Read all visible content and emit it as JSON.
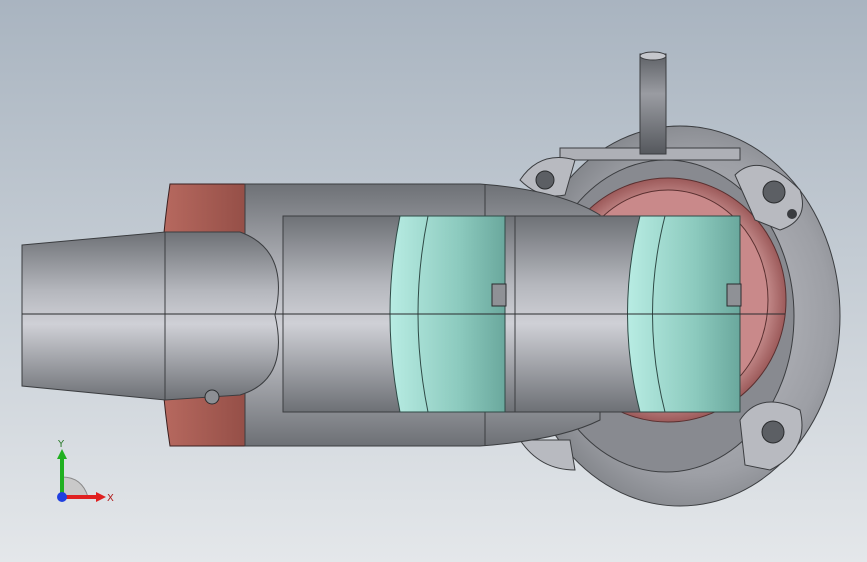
{
  "viewport": {
    "colors": {
      "background_top": "#a9b4c0",
      "background_bottom": "#e4e7ea",
      "body_gray": "#8c8f94",
      "body_light": "#c8c9cf",
      "flange_red": "#a45a52",
      "seal_teal": "#9fd3c8",
      "housing_gray": "#9a9ca0"
    }
  },
  "triad": {
    "x_label": "X",
    "y_label": "Y",
    "colors": {
      "x": "#e02020",
      "y": "#20b020",
      "z": "#2040e0"
    }
  }
}
